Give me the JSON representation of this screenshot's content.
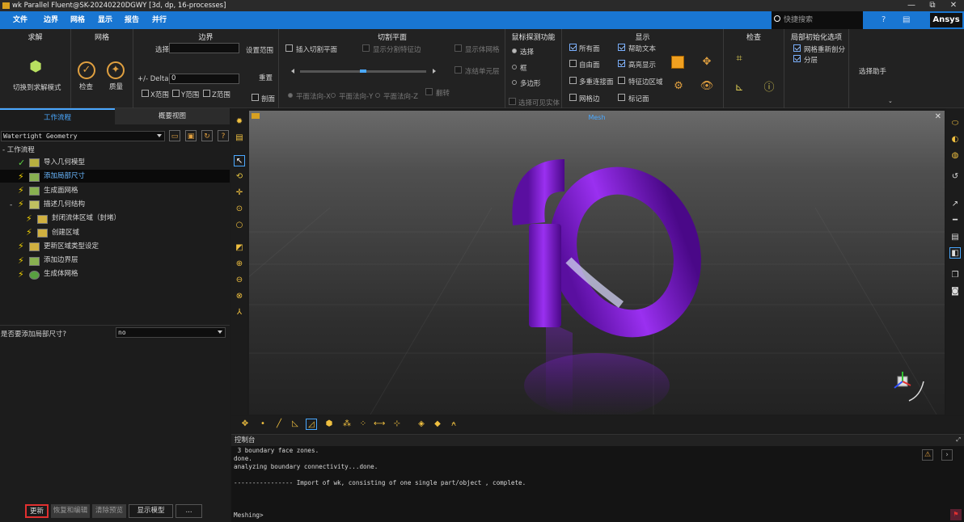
{
  "window": {
    "title": "wk Parallel Fluent@SK-20240220DGWY  [3d, dp, 16-processes]",
    "min": "—",
    "max": "⧉",
    "close": "✕"
  },
  "menu": {
    "items": [
      "文件",
      "边界",
      "网格",
      "显示",
      "报告",
      "并行"
    ],
    "collapse": "⌃",
    "search_placeholder": "快捷搜索",
    "brand": "Ansys"
  },
  "ribbon": {
    "solve": {
      "title": "求解",
      "btn": "切换到求解模式"
    },
    "mesh": {
      "title": "网格",
      "check": "检查",
      "quality": "质量"
    },
    "bounds": {
      "title": "边界",
      "select": "选择",
      "set_range": "设置范围",
      "delta": "+/- Delta",
      "delta_value": "0",
      "reset": "重置",
      "xr": "X范围",
      "yr": "Y范围",
      "zr": "Z范围",
      "cut": "剖面"
    },
    "cut": {
      "title": "切割平面",
      "insert": "插入切割平面",
      "show_split": "显示分割特征边",
      "show_volume": "显示体网格",
      "freeze": "冻结单元层",
      "px": "平面法向-X",
      "py": "平面法向-Y",
      "pz": "平面法向-Z",
      "flip": "翻转"
    },
    "probe": {
      "title": "鼠标探测功能",
      "select": "选择",
      "box": "框",
      "polygon": "多边形",
      "visible": "选择可见实体"
    },
    "display": {
      "title": "显示",
      "all_faces": "所有面",
      "free_faces": "自由面",
      "multi": "多重连接面",
      "mesh_edges": "网格边",
      "help_text": "帮助文本",
      "highlight": "高亮显示",
      "feature_edges": "特征边区域",
      "mark": "标记面"
    },
    "inspect": {
      "title": "检查"
    },
    "local": {
      "title": "局部初始化选项",
      "remesh": "网格重新剖分",
      "layer": "分层",
      "assist": "选择助手"
    }
  },
  "left": {
    "tabs": [
      "工作流程",
      "概要视图"
    ],
    "workflow_select": "Watertight Geometry",
    "tree_root": "工作流程",
    "tree": [
      "导入几何模型",
      "添加局部尺寸",
      "生成面网格",
      "描述几何结构",
      "封闭流体区域（封堵）",
      "创建区域",
      "更新区域类型设定",
      "添加边界层",
      "生成体网格"
    ],
    "question": "是否要添加局部尺寸?",
    "answer": "no",
    "buttons": [
      "更新",
      "恢复和编辑",
      "清除预览",
      "显示模型",
      "..."
    ]
  },
  "viewport": {
    "title": "Mesh",
    "close": "✕"
  },
  "console": {
    "title": "控制台",
    "text": " 3 boundary face zones.\ndone.\nanalyzing boundary connectivity...done.\n\n---------------- Import of wk, consisting of one single part/object , complete.\n\n\n\nMeshing>"
  },
  "colors": {
    "accent": "#1976d2",
    "model": "#7a18c8",
    "highlight": "#e03030"
  }
}
